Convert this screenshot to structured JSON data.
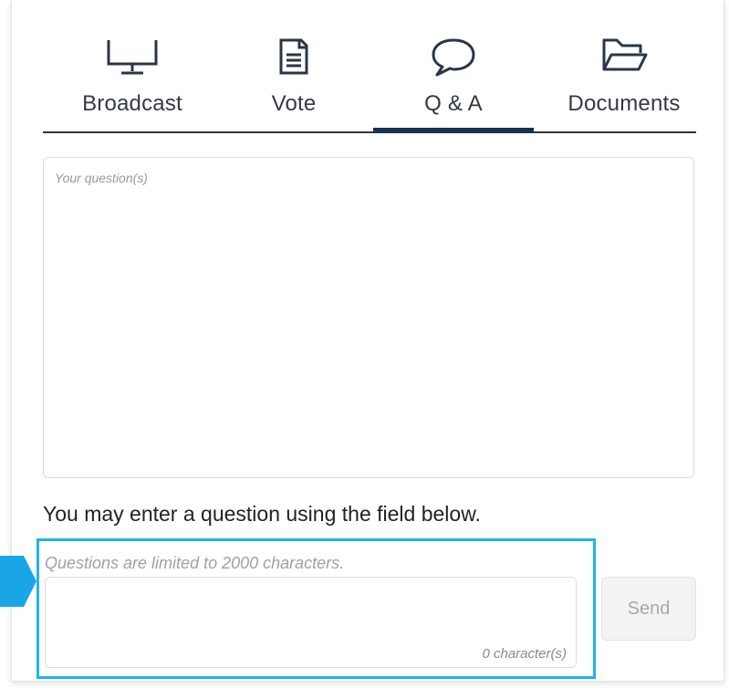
{
  "tabs": [
    {
      "label": "Broadcast",
      "icon": "monitor-icon"
    },
    {
      "label": "Vote",
      "icon": "document-icon"
    },
    {
      "label": "Q & A",
      "icon": "speech-bubble-icon"
    },
    {
      "label": "Documents",
      "icon": "folder-open-icon"
    }
  ],
  "active_tab": "Q & A",
  "questions_area": {
    "placeholder": "Your question(s)"
  },
  "intro_text": "You may enter a question using the field below.",
  "question_limit_text": "Questions are limited to 2000  characters.",
  "char_counter": "0 character(s)",
  "send_label": "Send",
  "colors": {
    "accent": "#17324d",
    "highlight": "#1db5ea",
    "pointer": "#1aa6e6"
  }
}
